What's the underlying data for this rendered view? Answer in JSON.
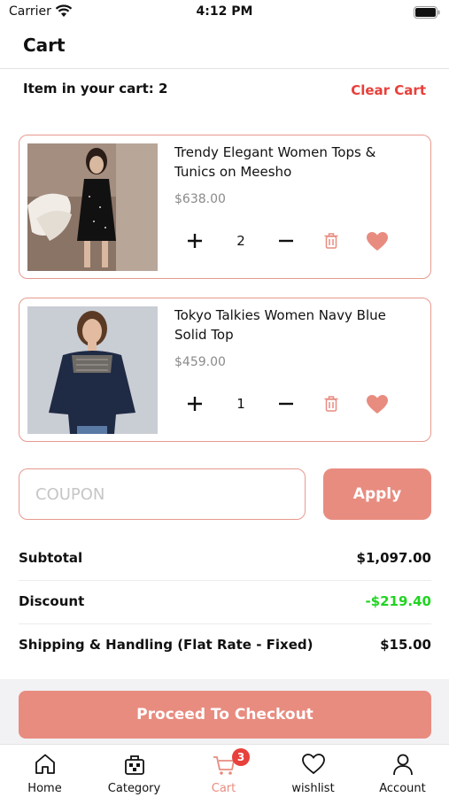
{
  "status_bar": {
    "carrier": "Carrier",
    "time": "4:12 PM"
  },
  "header": {
    "title": "Cart"
  },
  "cart_summary": {
    "count_text": "Item in your cart: 2",
    "clear_label": "Clear Cart"
  },
  "items": [
    {
      "title": "Trendy Elegant Women Tops & Tunics on Meesho",
      "price": "$638.00",
      "quantity": "2"
    },
    {
      "title": "Tokyo Talkies Women Navy Blue Solid Top",
      "price": "$459.00",
      "quantity": "1"
    }
  ],
  "coupon": {
    "placeholder": "COUPON",
    "value": "",
    "apply_label": "Apply"
  },
  "totals": {
    "subtotal_label": "Subtotal",
    "subtotal_value": "$1,097.00",
    "discount_label": "Discount",
    "discount_value": "-$219.40",
    "shipping_label": "Shipping & Handling (Flat Rate - Fixed)",
    "shipping_value": "$15.00"
  },
  "checkout": {
    "label": "Proceed To Checkout"
  },
  "tabs": [
    {
      "label": "Home",
      "icon": "home-icon"
    },
    {
      "label": "Category",
      "icon": "category-icon"
    },
    {
      "label": "Cart",
      "icon": "cart-icon",
      "badge": "3",
      "active": true
    },
    {
      "label": "wishlist",
      "icon": "heart-outline-icon"
    },
    {
      "label": "Account",
      "icon": "user-icon"
    }
  ],
  "colors": {
    "accent": "#e88c80",
    "danger": "#e8403b",
    "discount": "#21d421",
    "border": "#e79a8f"
  }
}
